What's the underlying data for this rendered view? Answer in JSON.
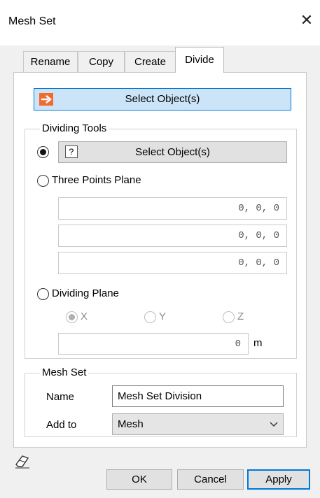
{
  "window": {
    "title": "Mesh Set",
    "close_icon": "close-icon"
  },
  "tabs": [
    {
      "label": "Rename",
      "active": false
    },
    {
      "label": "Copy",
      "active": false
    },
    {
      "label": "Create",
      "active": false
    },
    {
      "label": "Divide",
      "active": true
    }
  ],
  "select_objects": {
    "label": "Select Object(s)",
    "icon": "arrow-select-icon",
    "icon_color": "#f26a2e"
  },
  "dividing_tools": {
    "legend": "Dividing Tools",
    "select_objects_button": {
      "label": "Select Object(s)",
      "icon": "question-icon",
      "selected": true
    },
    "three_points_plane": {
      "label": "Three Points Plane",
      "selected": false,
      "points": [
        "0, 0, 0",
        "0, 0, 0",
        "0, 0, 0"
      ]
    },
    "dividing_plane": {
      "label": "Dividing Plane",
      "selected": false,
      "axes": [
        {
          "label": "X",
          "selected": true
        },
        {
          "label": "Y",
          "selected": false
        },
        {
          "label": "Z",
          "selected": false
        }
      ],
      "offset_value": "0",
      "offset_unit": "m"
    }
  },
  "mesh_set": {
    "legend": "Mesh Set",
    "name_label": "Name",
    "name_value": "Mesh Set Division",
    "add_to_label": "Add to",
    "add_to_value": "Mesh"
  },
  "footer": {
    "eraser_icon": "eraser-icon",
    "ok_label": "OK",
    "cancel_label": "Cancel",
    "apply_label": "Apply"
  }
}
